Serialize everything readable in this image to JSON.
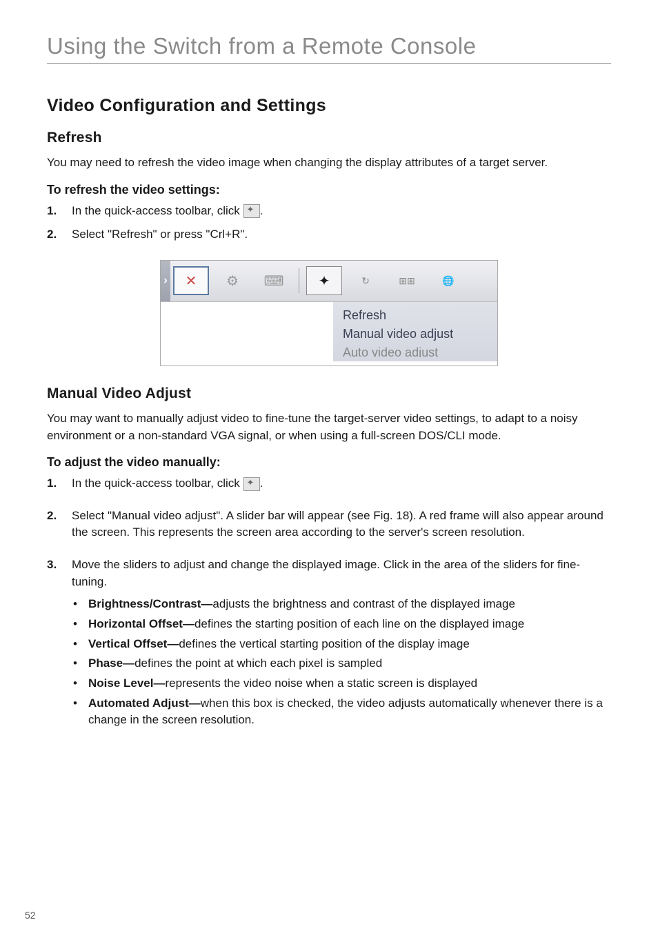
{
  "page": {
    "main_title": "Using the Switch from a Remote Console",
    "section_title": "Video Configuration and Settings",
    "page_number": "52"
  },
  "refresh": {
    "heading": "Refresh",
    "intro": "You may need to refresh the video image when changing the display attributes of a target server.",
    "label": "To refresh the video settings:",
    "step1_num": "1.",
    "step1_text_a": "In the quick-access toolbar, click ",
    "step1_text_b": ".",
    "step2_num": "2.",
    "step2_text": "Select \"Refresh\" or press \"Crl+R\"."
  },
  "screenshot_menu": {
    "item1": "Refresh",
    "item2": "Manual video adjust",
    "item3": "Auto video adjust"
  },
  "manual": {
    "heading": "Manual Video Adjust",
    "intro": "You may want to manually adjust video to fine-tune the target-server video settings, to adapt to a noisy environment or a non-standard VGA signal, or when using a full-screen DOS/CLI mode.",
    "label": "To adjust the video manually:",
    "step1_num": "1.",
    "step1_text_a": "In the quick-access toolbar, click ",
    "step1_text_b": ".",
    "step2_num": "2.",
    "step2_text": "Select \"Manual video adjust\". A slider bar will appear (see Fig. 18). A red frame will also appear around the screen. This represents the screen area according to the server's screen resolution.",
    "step3_num": "3.",
    "step3_text": "Move the sliders to adjust and change the displayed image. Click in the area of the sliders for fine-tuning."
  },
  "bullets": {
    "b1_label": "Brightness/Contrast—",
    "b1_text": "adjusts the brightness and contrast of the displayed image",
    "b2_label": "Horizontal Offset—",
    "b2_text": "defines the starting position of each line on the displayed image",
    "b3_label": "Vertical Offset—",
    "b3_text": "defines the vertical starting position of the display image",
    "b4_label": "Phase—",
    "b4_text": "defines the point at which each pixel is sampled",
    "b5_label": "Noise Level—",
    "b5_text": "represents the video noise when a static screen is displayed",
    "b6_label": "Automated Adjust—",
    "b6_text": "when this box is checked, the video adjusts automatically whenever there is a change in the screen resolution."
  }
}
